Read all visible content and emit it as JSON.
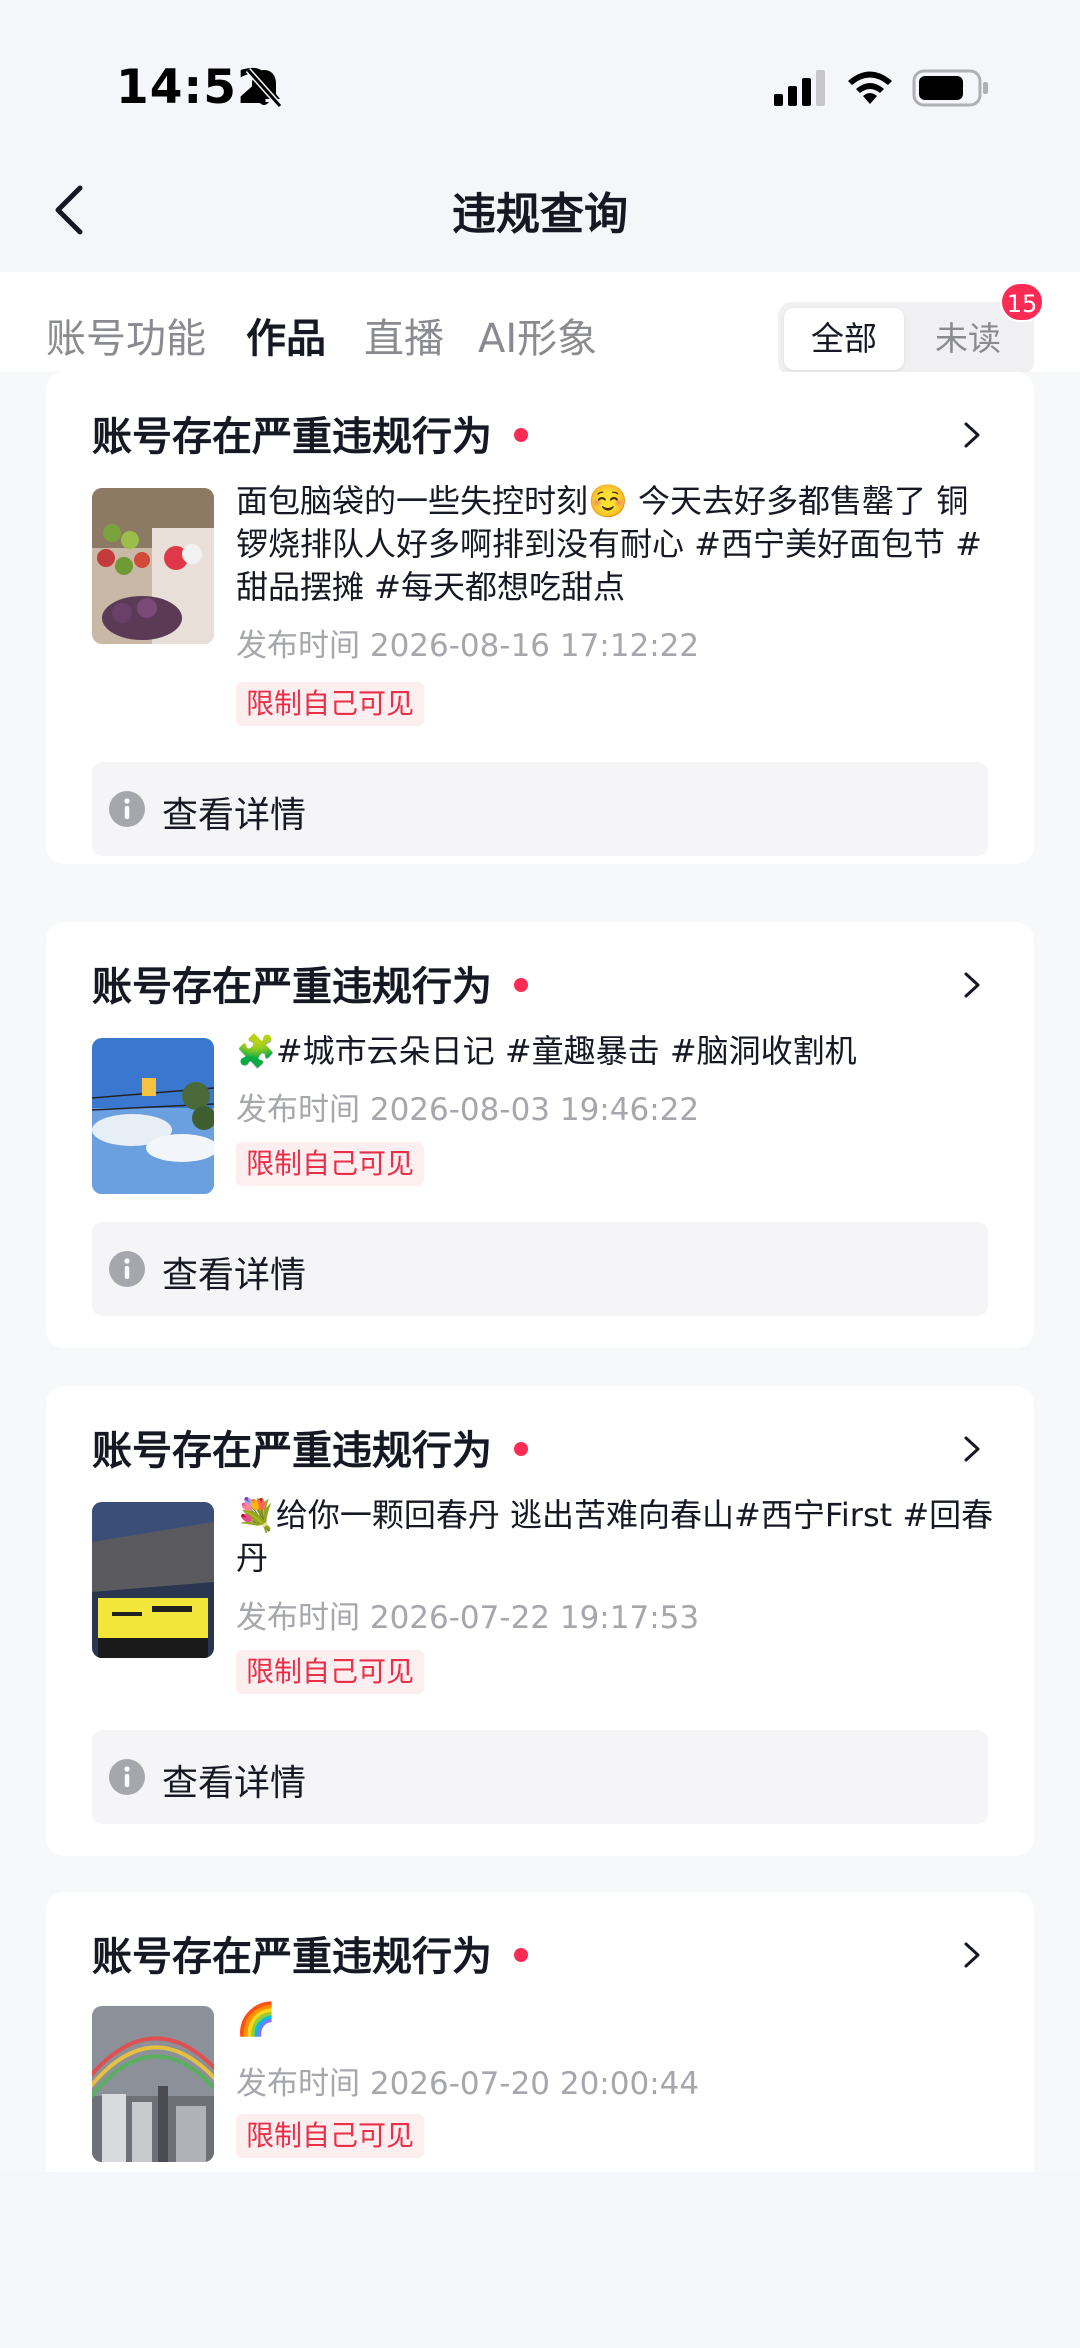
{
  "status_bar": {
    "time": "14:52"
  },
  "nav": {
    "title": "违规查询"
  },
  "tabs": [
    {
      "label": "账号功能",
      "active": false
    },
    {
      "label": "作品",
      "active": true
    },
    {
      "label": "直播",
      "active": false
    },
    {
      "label": "AI形象",
      "active": false
    }
  ],
  "filter": {
    "all_label": "全部",
    "unread_label": "未读",
    "unread_count": "15"
  },
  "cards": [
    {
      "title": "账号存在严重违规行为",
      "description": "面包脑袋的一些失控时刻☺️ 今天去好多都售罄了 铜锣烧排队人好多啊排到没有耐心 #西宁美好面包节 #甜品摆摊 #每天都想吃甜点",
      "publish_time": "发布时间 2026-08-16 17:12:22",
      "tag": "限制自己可见",
      "detail_label": "查看详情"
    },
    {
      "title": "账号存在严重违规行为",
      "description": "🧩#城市云朵日记 #童趣暴击 #脑洞收割机",
      "publish_time": "发布时间 2026-08-03 19:46:22",
      "tag": "限制自己可见",
      "detail_label": "查看详情"
    },
    {
      "title": "账号存在严重违规行为",
      "description": "💐给你一颗回春丹 逃出苦难向春山#西宁First #回春丹",
      "publish_time": "发布时间 2026-07-22 19:17:53",
      "tag": "限制自己可见",
      "detail_label": "查看详情"
    },
    {
      "title": "账号存在严重违规行为",
      "description": "🌈",
      "publish_time": "发布时间 2026-07-20 20:00:44",
      "tag": "限制自己可见"
    }
  ],
  "colors": {
    "accent_red": "#fe2c55",
    "tag_red": "#e8304a",
    "muted_text": "#a6a7ad"
  }
}
